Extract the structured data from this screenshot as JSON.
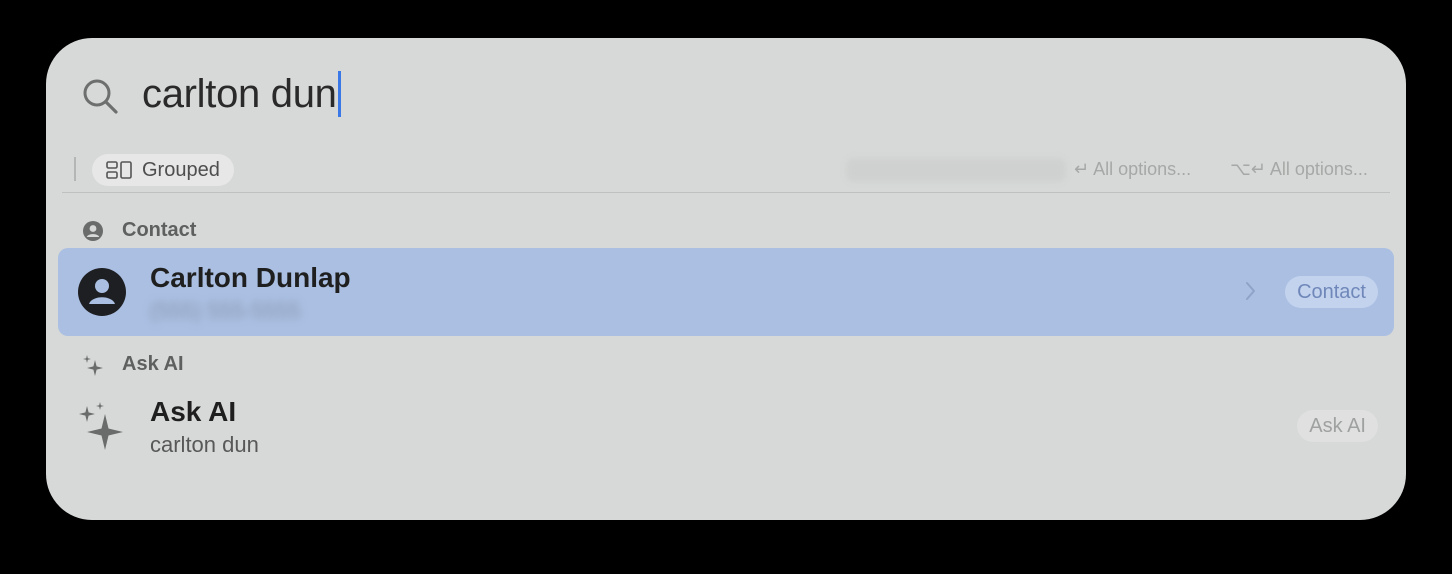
{
  "search": {
    "query": "carlton dun"
  },
  "toolbar": {
    "group_mode_label": "Grouped",
    "hint_primary": "All options...",
    "hint_primary_keys": "↵",
    "hint_secondary": "All options...",
    "hint_secondary_keys": "⌥↵"
  },
  "sections": [
    {
      "header": "Contact",
      "header_icon": "person-circle-icon",
      "results": [
        {
          "title": "Carlton Dunlap",
          "subtitle": "(555) 555-5555",
          "subtitle_redacted": true,
          "icon": "person-circle-icon",
          "badge": "Contact",
          "selected": true
        }
      ]
    },
    {
      "header": "Ask AI",
      "header_icon": "sparkles-icon",
      "results": [
        {
          "title": "Ask AI",
          "subtitle": "carlton dun",
          "icon": "sparkles-icon",
          "badge": "Ask AI",
          "selected": false
        }
      ]
    }
  ],
  "colors": {
    "panel_bg": "#d7d9d8",
    "selection_bg": "#aabfe2",
    "caret": "#3b78e7",
    "badge_selected_text": "#6f87b9"
  }
}
